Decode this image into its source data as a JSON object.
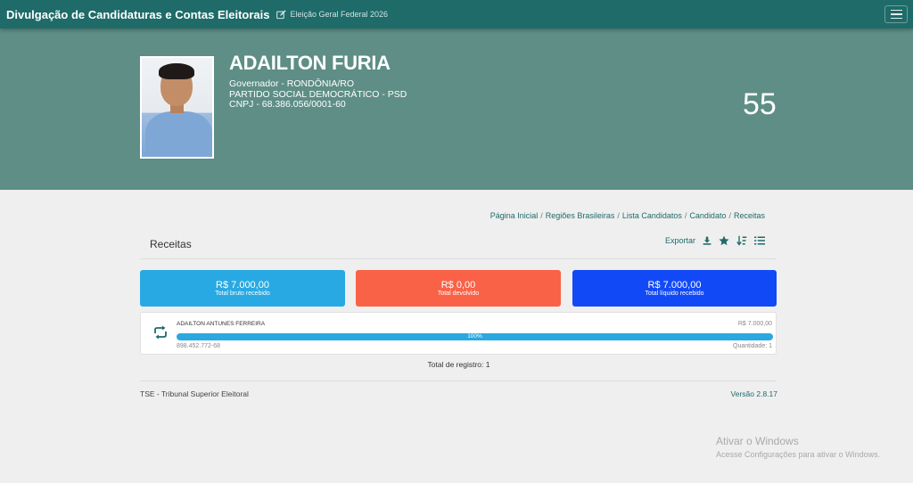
{
  "header": {
    "title": "Divulgação de Candidaturas e Contas Eleitorais",
    "election": "Eleição Geral Federal 2026"
  },
  "candidate": {
    "name": "ADAILTON FURIA",
    "office": "Governador - RONDÔNIA/RO",
    "party": "PARTIDO SOCIAL DEMOCRÁTICO - PSD",
    "cnpj": "CNPJ - 68.386.056/0001-60",
    "number": "55"
  },
  "breadcrumb": [
    "Página Inicial",
    "Regiões Brasileiras",
    "Lista Candidatos",
    "Candidato",
    "Receitas"
  ],
  "page": {
    "title": "Receitas",
    "export_label": "Exportar"
  },
  "summary": [
    {
      "value": "R$ 7.000,00",
      "label": "Total bruto recebido",
      "color": "#29a9e3"
    },
    {
      "value": "R$ 0,00",
      "label": "Total devolvido",
      "color": "#f96247"
    },
    {
      "value": "R$ 7.000,00",
      "label": "Total líquido recebido",
      "color": "#1249f7"
    }
  ],
  "receipts": [
    {
      "donor": "ADAILTON ANTUNES FERREIRA",
      "amount": "R$ 7.000,00",
      "percent_label": "100%",
      "percent": 100,
      "document": "898.452.772-68",
      "quantity": "Quantidade: 1"
    }
  ],
  "total_records": "Total de registro: 1",
  "footer": {
    "left": "TSE - Tribunal Superior Eleitoral",
    "right": "Versão 2.8.17"
  },
  "watermark": {
    "title": "Ativar o Windows",
    "subtitle": "Acesse Configurações para ativar o Windows."
  },
  "colors": {
    "primary": "#1e6b69",
    "hero": "#5e8e85"
  }
}
